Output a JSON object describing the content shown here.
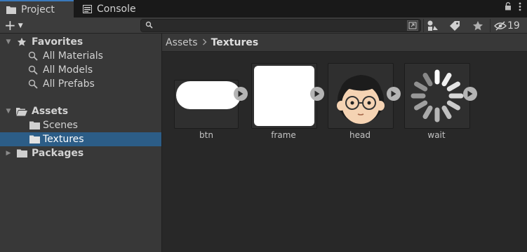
{
  "tabs": [
    {
      "label": "Project",
      "icon": "folder-icon",
      "active": true
    },
    {
      "label": "Console",
      "icon": "console-icon",
      "active": false
    }
  ],
  "window_controls": {
    "lock_icon": "lock-icon",
    "menu_icon": "kebab-menu-icon"
  },
  "toolbar": {
    "add_label": "+",
    "search_placeholder": "",
    "hidden_count": "19"
  },
  "tree": {
    "favorites": {
      "label": "Favorites",
      "items": [
        "All Materials",
        "All Models",
        "All Prefabs"
      ]
    },
    "assets": {
      "label": "Assets",
      "items": [
        "Scenes",
        "Textures"
      ],
      "selected": "Textures"
    },
    "packages": {
      "label": "Packages"
    }
  },
  "breadcrumb": {
    "root": "Assets",
    "separator": "›",
    "current": "Textures"
  },
  "assets": [
    {
      "name": "btn"
    },
    {
      "name": "frame"
    },
    {
      "name": "head"
    },
    {
      "name": "wait"
    }
  ],
  "colors": {
    "selection": "#2c5d87",
    "panel": "#383838",
    "background": "#282828",
    "tab_accent": "#3a79bb"
  }
}
